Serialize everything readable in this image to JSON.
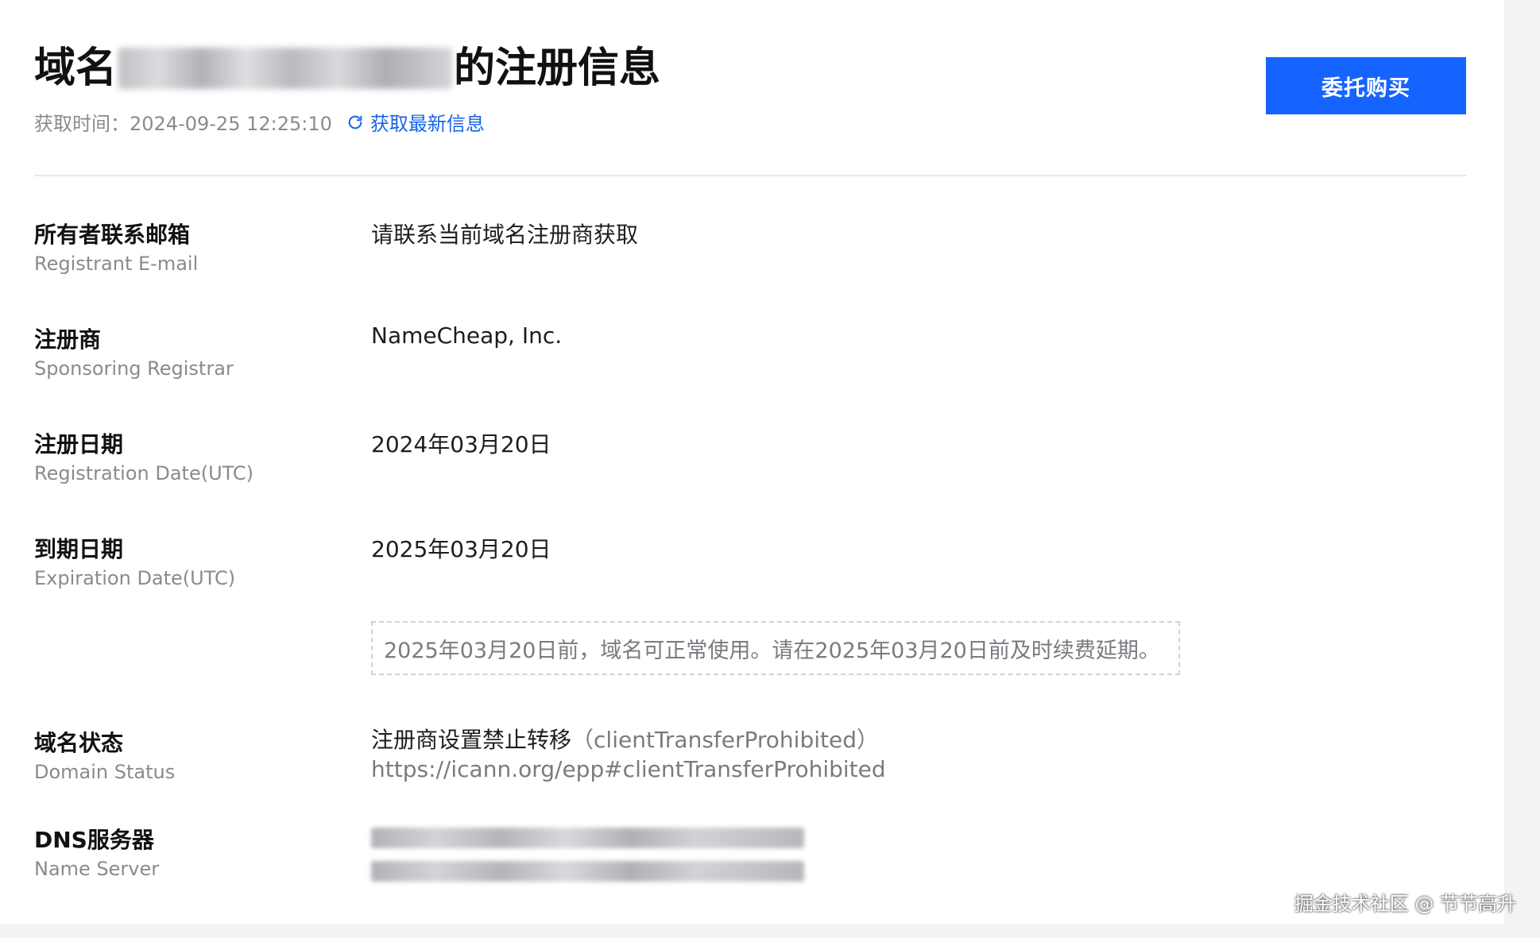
{
  "header": {
    "title_prefix": "域名",
    "title_suffix": "的注册信息",
    "fetch_time": "获取时间：2024-09-25 12:25:10",
    "refresh_label": "获取最新信息",
    "buy_button_label": "委托购买"
  },
  "fields": [
    {
      "label_cn": "所有者联系邮箱",
      "label_en": "Registrant E-mail",
      "value": "请联系当前域名注册商获取"
    },
    {
      "label_cn": "注册商",
      "label_en": "Sponsoring Registrar",
      "value": "NameCheap, Inc."
    },
    {
      "label_cn": "注册日期",
      "label_en": "Registration Date(UTC)",
      "value": "2024年03月20日"
    },
    {
      "label_cn": "到期日期",
      "label_en": "Expiration Date(UTC)",
      "value": "2025年03月20日"
    }
  ],
  "expiry_notice": "2025年03月20日前，域名可正常使用。请在2025年03月20日前及时续费延期。",
  "domain_status": {
    "label_cn": "域名状态",
    "label_en": "Domain Status",
    "status_text": "注册商设置禁止转移",
    "status_code": "（clientTransferProhibited）",
    "status_link": "https://icann.org/epp#clientTransferProhibited"
  },
  "dns": {
    "label_cn": "DNS服务器",
    "label_en": "Name Server"
  },
  "watermark": "掘金技术社区 @ 节节高升",
  "colors": {
    "accent": "#1664ff",
    "link": "#1664e8",
    "muted": "#8a8a8f"
  }
}
